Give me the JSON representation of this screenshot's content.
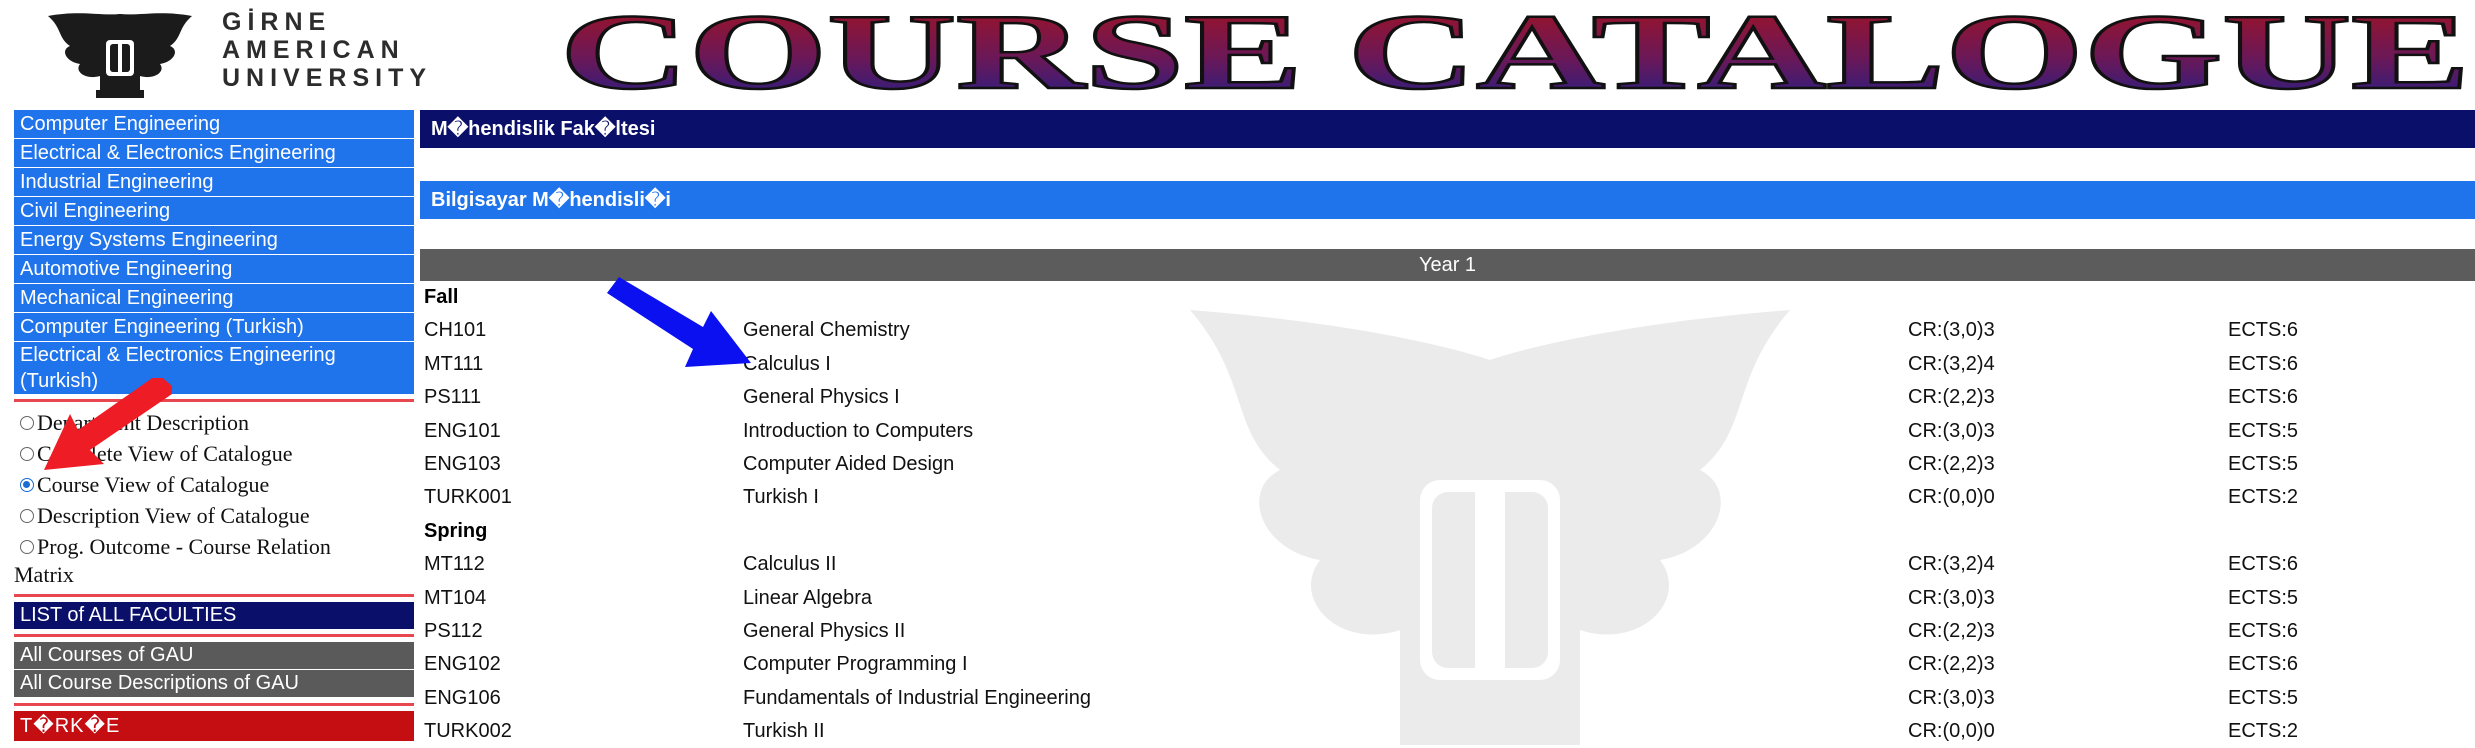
{
  "header": {
    "university_lines": [
      "GİRNE",
      "AMERICAN",
      "UNIVERSITY"
    ],
    "banner_title": "COURSE CATALOGUE"
  },
  "sidebar": {
    "departments": [
      "Computer Engineering",
      "Electrical & Electronics Engineering",
      "Industrial Engineering",
      "Civil Engineering",
      "Energy Systems Engineering",
      "Automotive Engineering",
      "Mechanical Engineering",
      "Computer Engineering (Turkish)",
      "Electrical & Electronics Engineering (Turkish)"
    ],
    "view_options": [
      {
        "label": "Department Description",
        "checked": false
      },
      {
        "label": "Complete View of Catalogue",
        "checked": false
      },
      {
        "label": "Course View of Catalogue",
        "checked": true
      },
      {
        "label": "Description View of Catalogue",
        "checked": false
      },
      {
        "label": "Prog. Outcome - Course Relation",
        "label_cont": "Matrix",
        "checked": false
      }
    ],
    "list_all_faculties": "LIST of ALL FACULTIES",
    "all_courses": "All Courses of GAU",
    "all_course_descriptions": "All Course Descriptions of GAU",
    "language_toggle": "T�RK�E"
  },
  "main": {
    "faculty_title": "M�hendislik Fak�ltesi",
    "department_title": "Bilgisayar M�hendisli�i",
    "year_label": "Year 1",
    "semesters": [
      {
        "name": "Fall",
        "courses": [
          {
            "code": "CH101",
            "name": "General Chemistry",
            "cr": "CR:(3,0)3",
            "ects": "ECTS:6"
          },
          {
            "code": "MT111",
            "name": "Calculus I",
            "cr": "CR:(3,2)4",
            "ects": "ECTS:6"
          },
          {
            "code": "PS111",
            "name": "General Physics I",
            "cr": "CR:(2,2)3",
            "ects": "ECTS:6"
          },
          {
            "code": "ENG101",
            "name": "Introduction to Computers",
            "cr": "CR:(3,0)3",
            "ects": "ECTS:5"
          },
          {
            "code": "ENG103",
            "name": "Computer Aided Design",
            "cr": "CR:(2,2)3",
            "ects": "ECTS:5"
          },
          {
            "code": "TURK001",
            "name": "Turkish I",
            "cr": "CR:(0,0)0",
            "ects": "ECTS:2"
          }
        ]
      },
      {
        "name": "Spring",
        "courses": [
          {
            "code": "MT112",
            "name": "Calculus II",
            "cr": "CR:(3,2)4",
            "ects": "ECTS:6"
          },
          {
            "code": "MT104",
            "name": "Linear Algebra",
            "cr": "CR:(3,0)3",
            "ects": "ECTS:5"
          },
          {
            "code": "PS112",
            "name": "General Physics II",
            "cr": "CR:(2,2)3",
            "ects": "ECTS:6"
          },
          {
            "code": "ENG102",
            "name": "Computer Programming I",
            "cr": "CR:(2,2)3",
            "ects": "ECTS:6"
          },
          {
            "code": "ENG106",
            "name": "Fundamentals of Industrial Engineering",
            "cr": "CR:(3,0)3",
            "ects": "ECTS:5"
          },
          {
            "code": "TURK002",
            "name": "Turkish II",
            "cr": "CR:(0,0)0",
            "ects": "ECTS:2"
          }
        ]
      }
    ]
  },
  "colors": {
    "dept_blue": "#1f74ec",
    "navy": "#0a0f6a",
    "gray_bar": "#5c5c5c",
    "red_bar": "#c40e12",
    "banner_red": "#a8121c",
    "banner_blue": "#1b1f8a"
  },
  "annotations": {
    "red_arrow": "points-to-course-view-radio",
    "blue_arrow": "points-to-calculus-i"
  }
}
